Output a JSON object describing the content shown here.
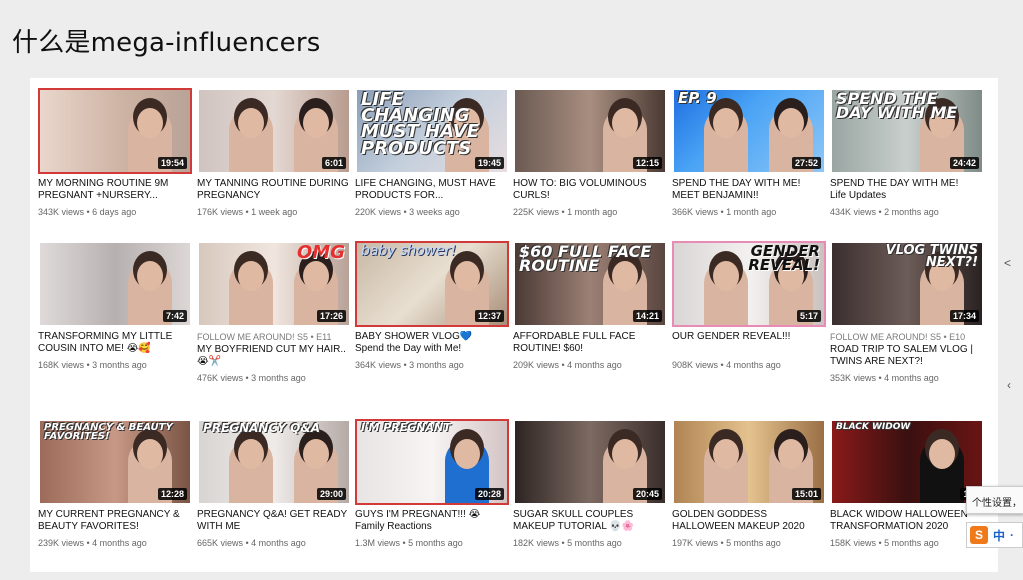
{
  "slide": {
    "title": "什么是mega-influencers"
  },
  "side_marks": [
    "<",
    "‹"
  ],
  "popup_text": "个性设置，",
  "ime": {
    "logo": "S",
    "label": "中",
    "extra": "·"
  },
  "videos": [
    {
      "title": "MY MORNING ROUTINE 9M PREGNANT +NURSERY...",
      "meta": "343K views • 6 days ago",
      "duration": "19:54",
      "overlay": "",
      "series": ""
    },
    {
      "title": "MY TANNING ROUTINE DURING PREGNANCY",
      "meta": "176K views • 1 week ago",
      "duration": "6:01",
      "overlay": "",
      "series": ""
    },
    {
      "title": "LIFE CHANGING, MUST HAVE PRODUCTS FOR...",
      "meta": "220K views • 3 weeks ago",
      "duration": "19:45",
      "overlay": "LIFE CHANGING MUST HAVE PRODUCTS",
      "series": ""
    },
    {
      "title": "HOW TO: BIG VOLUMINOUS CURLS!",
      "meta": "225K views • 1 month ago",
      "duration": "12:15",
      "overlay": "",
      "series": ""
    },
    {
      "title": "SPEND THE DAY WITH ME! MEET BENJAMIN!!",
      "meta": "366K views • 1 month ago",
      "duration": "27:52",
      "overlay": "EP. 9",
      "series": ""
    },
    {
      "title": "SPEND THE DAY WITH ME!",
      "subtitle": "Life Updates",
      "meta": "434K views • 2 months ago",
      "duration": "24:42",
      "overlay": "SPEND THE DAY WITH ME",
      "series": ""
    },
    {
      "title": "TRANSFORMING MY LITTLE COUSIN INTO ME! 😭🥰",
      "meta": "168K views • 3 months ago",
      "duration": "7:42",
      "overlay": "",
      "series": ""
    },
    {
      "title": "MY BOYFRIEND CUT MY HAIR.. 😭✂️",
      "meta": "476K views • 3 months ago",
      "duration": "17:26",
      "overlay": "OMG",
      "series": "FOLLOW ME AROUND!  S5 • E11"
    },
    {
      "title": "BABY SHOWER VLOG💙",
      "subtitle": "Spend the Day with Me!",
      "meta": "364K views • 3 months ago",
      "duration": "12:37",
      "overlay": "baby shower!",
      "series": ""
    },
    {
      "title": "AFFORDABLE FULL FACE ROUTINE! $60!",
      "meta": "209K views • 4 months ago",
      "duration": "14:21",
      "overlay": "$60 FULL FACE ROUTINE",
      "series": ""
    },
    {
      "title": "OUR GENDER REVEAL!!!",
      "meta": "908K views • 4 months ago",
      "duration": "5:17",
      "overlay": "GENDER REVEAL!",
      "series": ""
    },
    {
      "title": "ROAD TRIP TO SALEM VLOG | TWINS ARE NEXT?!",
      "meta": "353K views • 4 months ago",
      "duration": "17:34",
      "overlay": "VLOG TWINS NEXT?!",
      "series": "FOLLOW ME AROUND!  S5 • E10"
    },
    {
      "title": "MY CURRENT PREGNANCY & BEAUTY FAVORITES!",
      "meta": "239K views • 4 months ago",
      "duration": "12:28",
      "overlay": "PREGNANCY & BEAUTY FAVORITES!",
      "series": ""
    },
    {
      "title": "PREGNANCY Q&A! GET READY WITH ME",
      "meta": "665K views • 4 months ago",
      "duration": "29:00",
      "overlay": "PREGNANCY Q&A",
      "series": ""
    },
    {
      "title": "GUYS I'M PREGNANT!!! 😭",
      "subtitle": "Family Reactions",
      "meta": "1.3M views • 5 months ago",
      "duration": "20:28",
      "overlay": "I'M PREGNANT",
      "series": ""
    },
    {
      "title": "SUGAR SKULL COUPLES MAKEUP TUTORIAL 💀🌸",
      "meta": "182K views • 5 months ago",
      "duration": "20:45",
      "overlay": "",
      "series": ""
    },
    {
      "title": "GOLDEN GODDESS HALLOWEEN MAKEUP 2020",
      "meta": "197K views • 5 months ago",
      "duration": "15:01",
      "overlay": "",
      "series": ""
    },
    {
      "title": "BLACK WIDOW HALLOWEEN TRANSFORMATION 2020",
      "meta": "158K views • 5 months ago",
      "duration": "11:",
      "overlay": "BLACK WIDOW",
      "series": ""
    }
  ]
}
